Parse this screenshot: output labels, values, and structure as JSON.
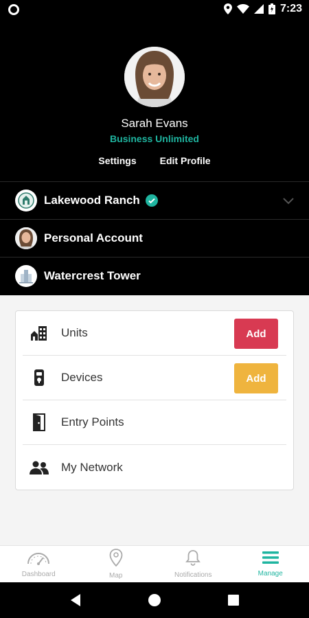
{
  "status_bar": {
    "time": "7:23"
  },
  "profile": {
    "name": "Sarah Evans",
    "plan": "Business Unlimited",
    "settings_label": "Settings",
    "edit_profile_label": "Edit Profile"
  },
  "accounts": [
    {
      "label": "Lakewood Ranch",
      "verified": true,
      "icon": "community-logo-icon"
    },
    {
      "label": "Personal Account",
      "icon": "user-avatar"
    },
    {
      "label": "Watercrest Tower",
      "icon": "building-logo-icon"
    }
  ],
  "manage": {
    "items": [
      {
        "label": "Units",
        "icon": "units-building-icon",
        "action": "Add",
        "action_color": "#d83a52"
      },
      {
        "label": "Devices",
        "icon": "device-lock-icon",
        "action": "Add",
        "action_color": "#efb43e"
      },
      {
        "label": "Entry Points",
        "icon": "door-icon"
      },
      {
        "label": "My Network",
        "icon": "people-icon"
      }
    ]
  },
  "bottom_nav": [
    {
      "label": "Dashboard",
      "icon": "speedometer-icon",
      "active": false
    },
    {
      "label": "Map",
      "icon": "map-pin-icon",
      "active": false
    },
    {
      "label": "Notifications",
      "icon": "bell-icon",
      "active": false
    },
    {
      "label": "Manage",
      "icon": "menu-icon",
      "active": true
    }
  ],
  "colors": {
    "accent": "#1fb5a0",
    "danger": "#d83a52",
    "warning": "#efb43e"
  }
}
